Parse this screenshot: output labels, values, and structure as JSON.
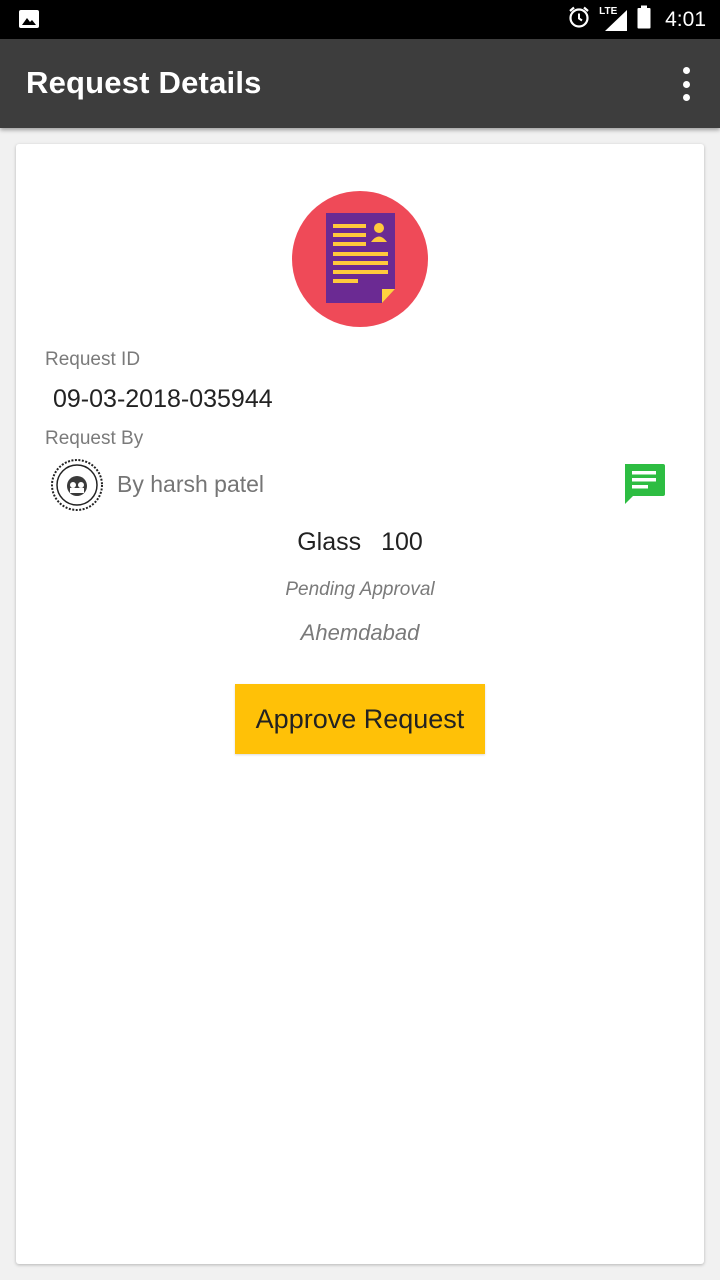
{
  "status_bar": {
    "time": "4:01",
    "network": "LTE",
    "icons": [
      "image-icon",
      "alarm-icon",
      "signal-icon",
      "battery-icon"
    ]
  },
  "toolbar": {
    "title": "Request Details",
    "menu_icon": "more-vert-icon"
  },
  "request": {
    "id_label": "Request ID",
    "id_value": "09-03-2018-035944",
    "by_label": "Request By",
    "requester": "By harsh patel",
    "item_name": "Glass",
    "item_quantity": "100",
    "status": "Pending Approval",
    "location": "Ahemdabad"
  },
  "actions": {
    "approve_label": "Approve Request"
  },
  "colors": {
    "toolbar": "#3d3d3d",
    "avatar_circle": "#ef4a58",
    "document": "#6b2a93",
    "document_lines": "#ffc93c",
    "chat_icon": "#2dbd42",
    "approve_button": "#ffc107"
  }
}
